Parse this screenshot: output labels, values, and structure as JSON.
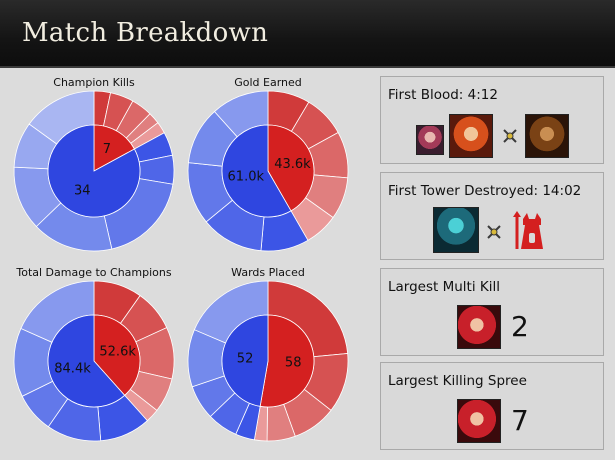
{
  "header": {
    "title": "Match Breakdown"
  },
  "charts": [
    {
      "title": "Champion Kills",
      "red_label": "7",
      "blue_label": "34"
    },
    {
      "title": "Gold Earned",
      "red_label": "43.6k",
      "blue_label": "61.0k"
    },
    {
      "title": "Total Damage to Champions",
      "red_label": "52.6k",
      "blue_label": "84.4k"
    },
    {
      "title": "Wards Placed",
      "red_label": "58",
      "blue_label": "52"
    }
  ],
  "events": {
    "first_blood": {
      "label": "First Blood: 4:12"
    },
    "first_tower": {
      "label": "First Tower Destroyed: 14:02"
    },
    "largest_multi_kill": {
      "label": "Largest Multi Kill",
      "value": "2"
    },
    "largest_killing_spree": {
      "label": "Largest Killing Spree",
      "value": "7"
    }
  },
  "colors": {
    "red_team": "#d42020",
    "blue_team": "#2f46e0"
  },
  "icons": [
    "champion-portrait-icon",
    "crossed-swords-icon",
    "tower-icon"
  ],
  "chart_data": [
    {
      "type": "pie",
      "title": "Champion Kills",
      "categories": [
        "Red team",
        "Blue team"
      ],
      "values": [
        7,
        34
      ],
      "outer_ring": {
        "red": [
          7,
          10,
          9,
          5,
          5
        ],
        "blue": [
          14,
          17,
          55,
          48,
          38,
          27,
          44
        ]
      }
    },
    {
      "type": "pie",
      "title": "Gold Earned",
      "categories": [
        "Red team",
        "Blue team"
      ],
      "values": [
        43.6,
        61.0
      ],
      "outer_ring": {
        "red": [
          10,
          10,
          11,
          10,
          8
        ],
        "blue": [
          10,
          13,
          13,
          12,
          12
        ]
      }
    },
    {
      "type": "pie",
      "title": "Total Damage to Champions",
      "categories": [
        "Red team",
        "Blue team"
      ],
      "values": [
        52.6,
        84.4
      ],
      "outer_ring": {
        "red": [
          14,
          12,
          15,
          10,
          4
        ],
        "blue": [
          14,
          15,
          11,
          19,
          25
        ]
      }
    },
    {
      "type": "pie",
      "title": "Wards Placed",
      "categories": [
        "Red team",
        "Blue team"
      ],
      "values": [
        58,
        52
      ],
      "outer_ring": {
        "red": [
          37,
          19,
          14,
          9,
          4
        ],
        "blue": [
          5,
          8,
          9,
          15,
          24
        ]
      }
    }
  ]
}
